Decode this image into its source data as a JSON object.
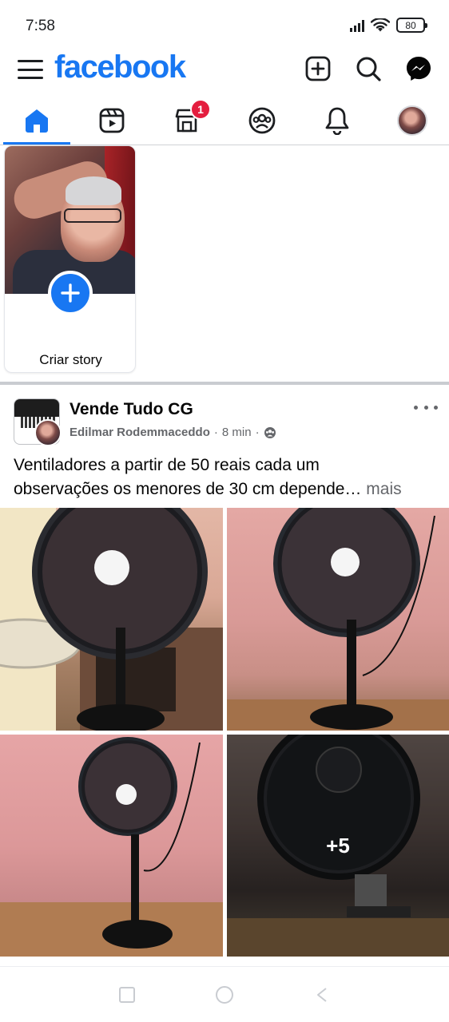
{
  "status_bar": {
    "time": "7:58",
    "battery": "80"
  },
  "header": {
    "logo": "facebook"
  },
  "nav": {
    "marketplace_badge": "1"
  },
  "stories": {
    "create_label": "Criar story"
  },
  "post": {
    "group_name": "Vende Tudo CG",
    "author": "Edilmar Rodemmaceddo",
    "time": "8 min",
    "text_line1": "Ventiladores a partir de 50 reais cada um",
    "text_line2": "observações os menores de 30 cm depende…",
    "more_label": "mais",
    "extra_photos": "+5"
  },
  "colors": {
    "brand": "#1877f2",
    "badge": "#e41e3f"
  }
}
